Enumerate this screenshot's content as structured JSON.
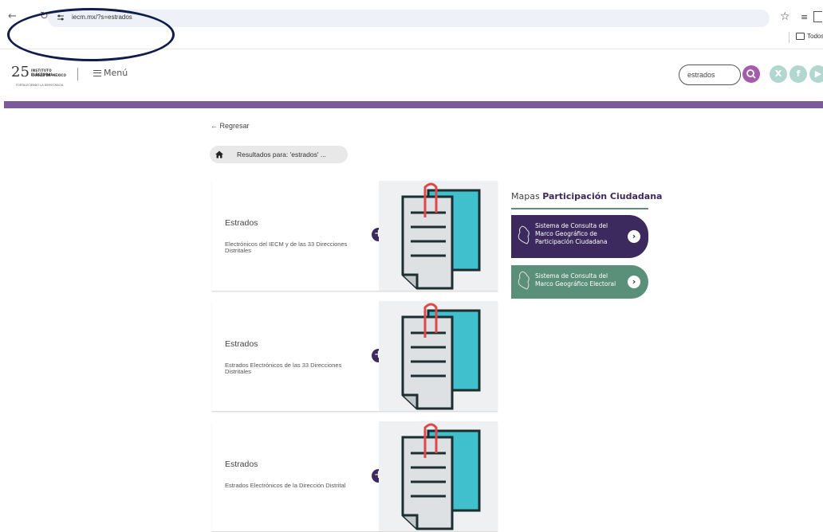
{
  "browser": {
    "url": "iecm.mx/?s=estrados",
    "bookmark_folder": "Todos"
  },
  "header": {
    "logo": {
      "number": "25",
      "line1": "INSTITUTO ELECTORAL",
      "line2": "CIUDAD DE MÉXICO",
      "line3": "FORTALECIENDO LA DEMOCRACIA"
    },
    "menu_label": "Menú",
    "search_value": "estrados",
    "social": [
      "X",
      "f",
      "▶"
    ]
  },
  "content": {
    "back_label": "Regresar",
    "breadcrumb_text": "Resultados para: 'estrados' ..."
  },
  "results": [
    {
      "title": "Estrados",
      "desc": "Electrónicos del IECM y de las 33 Direcciones Distritales"
    },
    {
      "title": "Estrados",
      "desc": "Estrados Electrónicos de las 33 Direcciones Distritales"
    },
    {
      "title": "Estrados",
      "desc": "Estrados Electrónicos de la Dirección Distrital"
    }
  ],
  "maps": {
    "title_plain": "Mapas",
    "title_bold": "Participación Ciudadana",
    "buttons": [
      {
        "label": "Sistema de Consulta del Marco Geográfico de Participación Ciudadana",
        "color": "#3c2a5e"
      },
      {
        "label": "Sistema de Consulta del Marco Geográfico Electoral",
        "color": "#5a8f7a"
      }
    ]
  },
  "colors": {
    "purple_bar": "#7b5b99",
    "accent_dark": "#3c2a5e",
    "search_btn": "#a35ea9",
    "social_bg": "#b2d7cf",
    "teal": "#3fc0cc"
  }
}
